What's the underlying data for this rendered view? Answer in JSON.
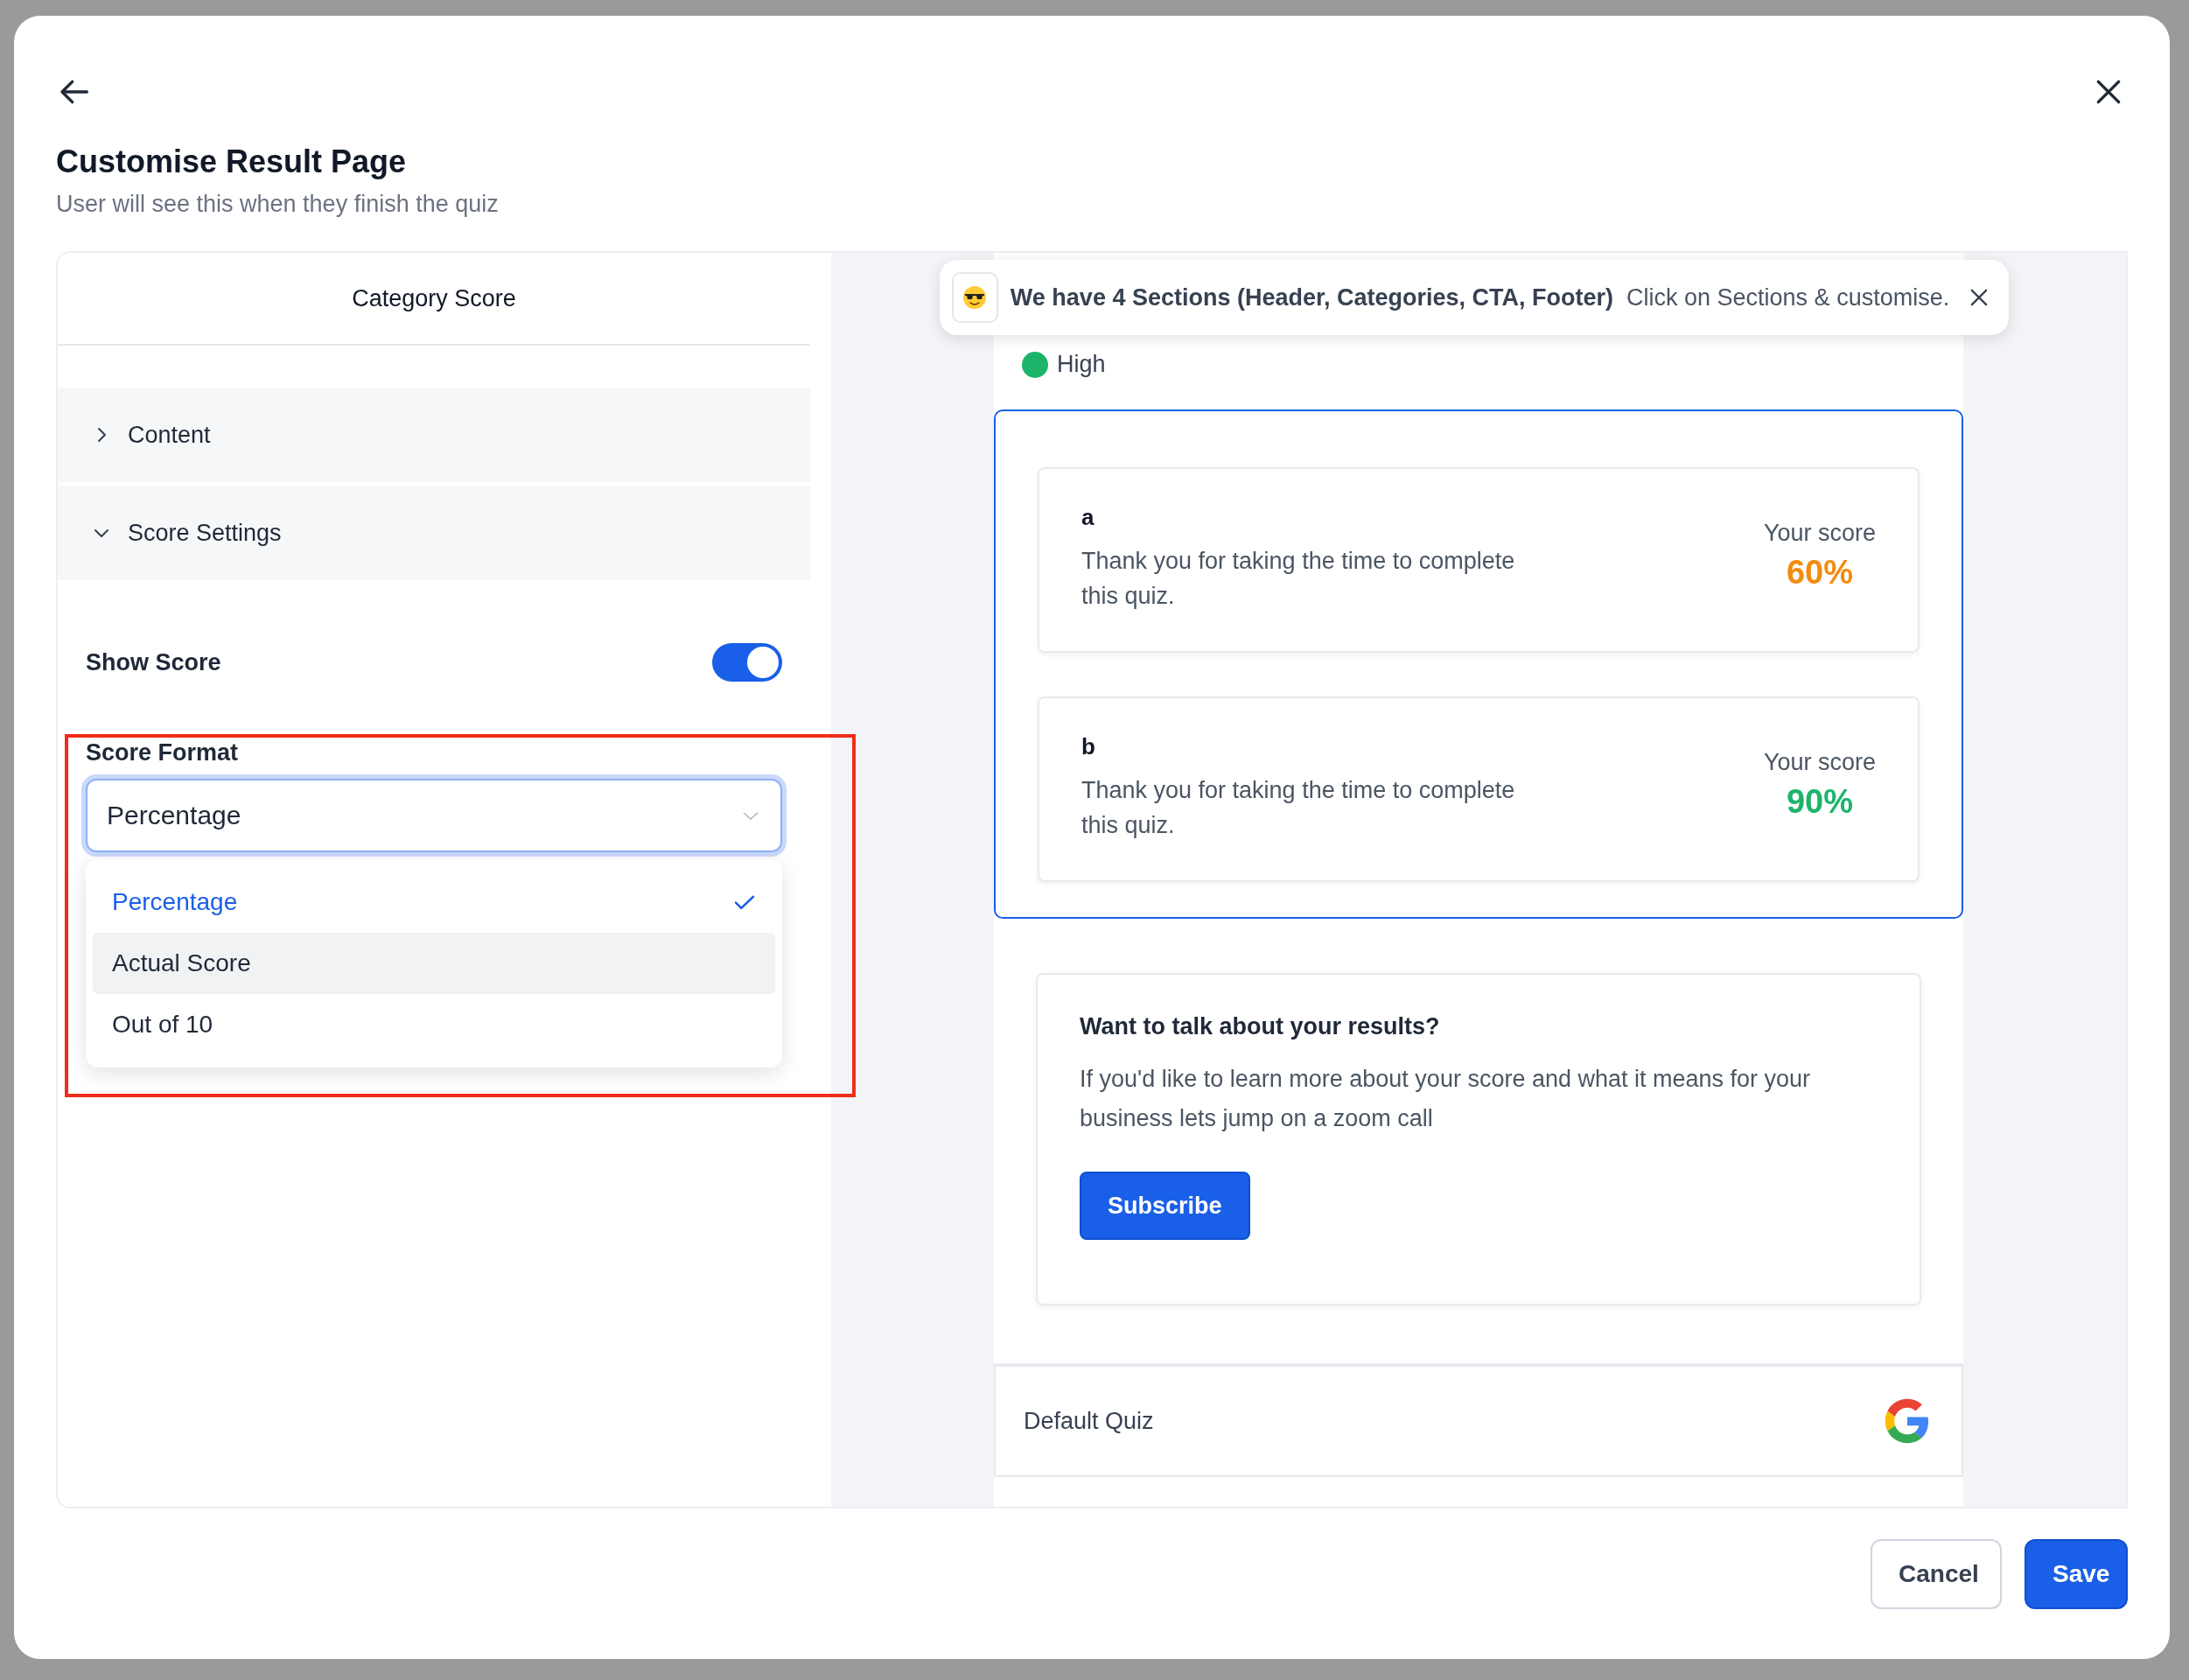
{
  "dialog": {
    "title": "Customise Result Page",
    "subtitle": "User will see this when they finish the quiz"
  },
  "editor": {
    "tab": "Category Score",
    "sections": [
      {
        "label": "Content",
        "expanded": false
      },
      {
        "label": "Score Settings",
        "expanded": true
      }
    ],
    "show_score": {
      "label": "Show Score",
      "on": true
    },
    "score_format": {
      "label": "Score Format",
      "value": "Percentage",
      "open": true,
      "options": [
        {
          "label": "Percentage",
          "selected": true,
          "hovered": false
        },
        {
          "label": "Actual Score",
          "selected": false,
          "hovered": true
        },
        {
          "label": "Out of 10",
          "selected": false,
          "hovered": false
        }
      ]
    }
  },
  "preview": {
    "toast": {
      "text": "**We have 4 Sections (Header, Categories, CTA, Footer)**  Click on Sections & customise."
    },
    "legend": [
      {
        "label": "High",
        "color": "#1db46a"
      }
    ],
    "categories": [
      {
        "name": "a",
        "text": "Thank you for taking the time to complete this quiz.",
        "score_label": "Your score",
        "score": "60%",
        "color": "#f28c0f"
      },
      {
        "name": "b",
        "text": "Thank you for taking the time to complete this quiz.",
        "score_label": "Your score",
        "score": "90%",
        "color": "#1db46a"
      }
    ],
    "cta": {
      "title": "Want to talk about your results?",
      "text": "If you'd like to learn more about your score and what it means for your business lets jump on a zoom call",
      "button": "Subscribe"
    },
    "footer": {
      "text": "Default Quiz"
    }
  },
  "buttons": [
    {
      "label": "Cancel",
      "kind": "secondary"
    },
    {
      "label": "Save",
      "kind": "primary"
    }
  ]
}
